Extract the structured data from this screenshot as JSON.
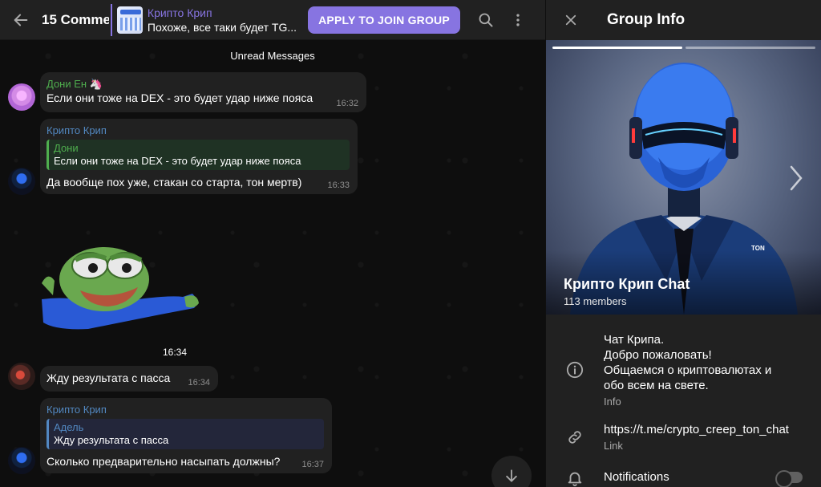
{
  "header": {
    "topic_title": "15 Comme",
    "pinned_name": "Крипто Крип",
    "pinned_preview": "Похоже, все таки будет TG...",
    "join_label": "APPLY TO JOIN GROUP",
    "icons": [
      "back-arrow-icon",
      "search-icon",
      "more-vertical-icon"
    ]
  },
  "chat": {
    "unread_label": "Unread Messages",
    "messages": [
      {
        "sender": "Дони Ен 🦄",
        "text": "Если они тоже на DEX - это будет удар ниже пояса",
        "time": "16:32",
        "sender_color": "#4fae4e"
      },
      {
        "sender": "Крипто Крип",
        "reply_name": "Дони",
        "reply_text": "Если они тоже на DEX - это будет удар ниже пояса",
        "text": "Да вообще пох уже, стакан со старта, тон мертв)",
        "time": "16:33",
        "sender_color": "#5288c1"
      },
      {
        "sticker": "pepe-sticker",
        "time": "16:34"
      },
      {
        "text": "Жду результата с пасса",
        "time": "16:34"
      },
      {
        "sender": "Крипто Крип",
        "reply_name": "Адель",
        "reply_text": "Жду результата с пасса",
        "text": "Сколько предварительно насыпать должны?",
        "time": "16:37",
        "sender_color": "#5288c1"
      }
    ]
  },
  "panel": {
    "title": "Group Info",
    "group_name": "Крипто Крип Chat",
    "members": "113 members",
    "photo_text": "TON",
    "info": {
      "line1": "Чат Крипа.",
      "line2": "Добро пожаловать!",
      "line3": "Общаемся о криптовалютах и",
      "line4": "обо всем на свете.",
      "label": "Info"
    },
    "link": {
      "value": "https://t.me/crypto_creep_ton_chat",
      "label": "Link"
    },
    "notifications": {
      "label": "Notifications",
      "enabled": false
    }
  },
  "colors": {
    "accent": "#8774e1",
    "bubble": "#212121",
    "panel": "#212121",
    "green_name": "#4fae4e",
    "blue_name": "#5288c1"
  }
}
